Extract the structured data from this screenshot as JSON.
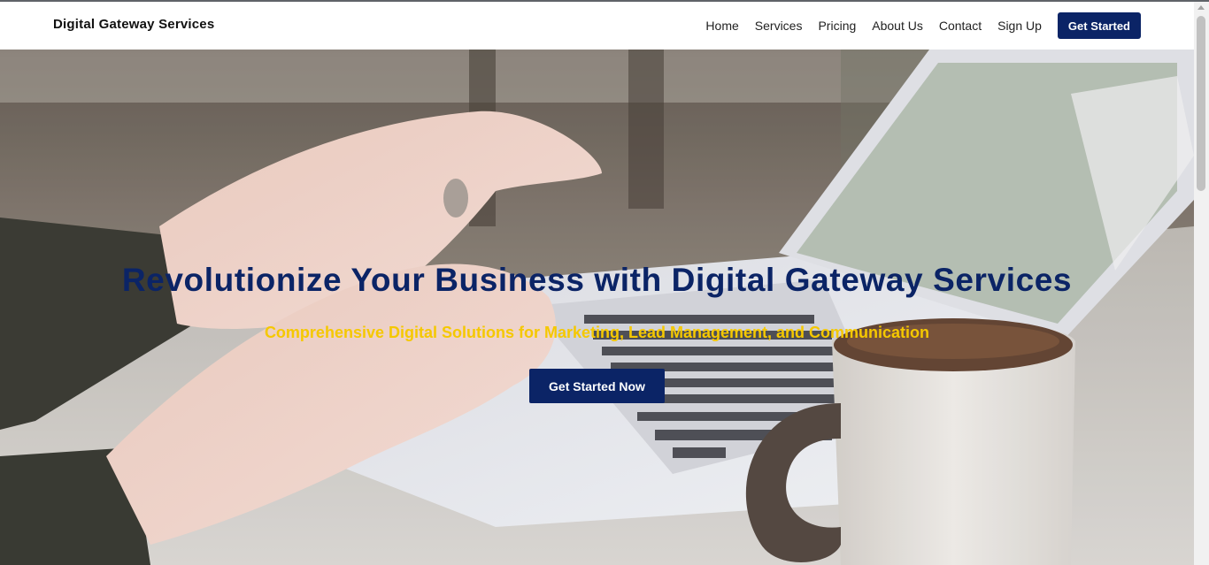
{
  "header": {
    "brand": "Digital Gateway Services",
    "nav": [
      "Home",
      "Services",
      "Pricing",
      "About Us",
      "Contact",
      "Sign Up"
    ],
    "cta_label": "Get Started"
  },
  "hero": {
    "title": "Revolutionize Your Business with Digital Gateway Services",
    "subtitle": "Comprehensive Digital Solutions for Marketing, Lead Management, and Communication",
    "cta_label": "Get Started Now",
    "image": "person-typing-on-laptop-with-coffee-mug"
  },
  "colors": {
    "brand_navy": "#0b2466",
    "accent_yellow": "#f5c800",
    "header_bg": "#ffffff"
  }
}
